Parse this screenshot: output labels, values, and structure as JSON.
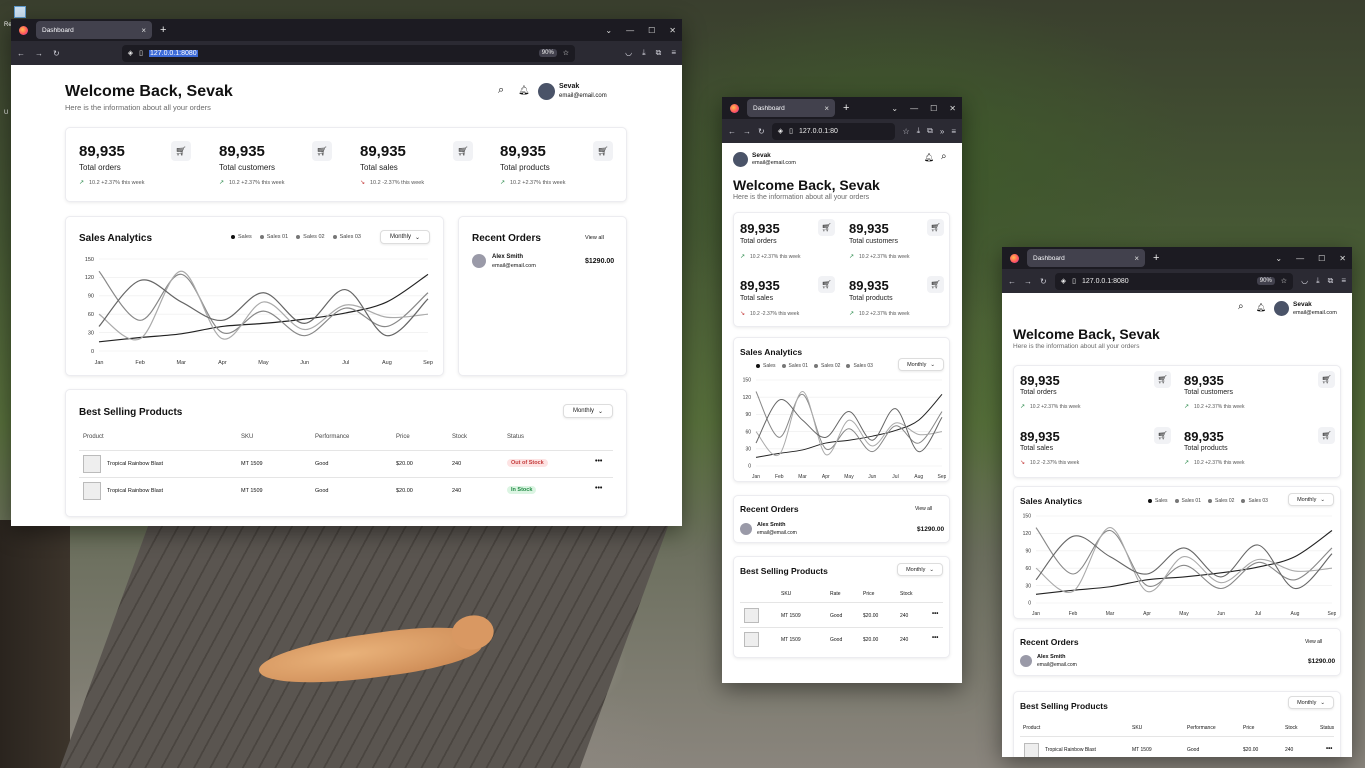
{
  "desktop": {
    "icon_label_1": "Re",
    "icon_label_2": "U"
  },
  "browser": {
    "tab_title": "Dashboard",
    "url": "127.0.0.1:8080",
    "url_small": "127.0.0.1:80",
    "zoom": "90%"
  },
  "header": {
    "title": "Welcome Back, Sevak",
    "subtitle": "Here is the information about all your orders",
    "user_name": "Sevak",
    "user_email": "email@email.com"
  },
  "stats": [
    {
      "value": "89,935",
      "label": "Total orders",
      "change": "10.2 +2.37% this week",
      "trend": "up"
    },
    {
      "value": "89,935",
      "label": "Total customers",
      "change": "10.2 +2.37% this week",
      "trend": "up"
    },
    {
      "value": "89,935",
      "label": "Total sales",
      "change": "10.2 -2.37% this week",
      "trend": "down"
    },
    {
      "value": "89,935",
      "label": "Total products",
      "change": "10.2 +2.37% this week",
      "trend": "up"
    }
  ],
  "sales_analytics": {
    "title": "Sales Analytics",
    "period": "Monthly",
    "legend": [
      "Sales",
      "Sales 01",
      "Sales 02",
      "Sales 03"
    ]
  },
  "chart_data": {
    "type": "line",
    "title": "Sales Analytics",
    "categories": [
      "Jan",
      "Feb",
      "Mar",
      "Apr",
      "May",
      "Jun",
      "Jul",
      "Aug",
      "Sep"
    ],
    "yticks": [
      0,
      30,
      60,
      90,
      120,
      150
    ],
    "ylim": [
      0,
      150
    ],
    "grid": true,
    "legend_position": "top-right",
    "series": [
      {
        "name": "Sales",
        "values": [
          15,
          22,
          28,
          40,
          45,
          52,
          62,
          80,
          125
        ],
        "color": "#222222"
      },
      {
        "name": "Sales 01",
        "values": [
          130,
          50,
          125,
          30,
          65,
          25,
          70,
          40,
          95
        ],
        "color": "#888888"
      },
      {
        "name": "Sales 02",
        "values": [
          60,
          20,
          130,
          20,
          80,
          35,
          75,
          55,
          60
        ],
        "color": "#aaaaaa"
      },
      {
        "name": "Sales 03",
        "values": [
          40,
          115,
          80,
          50,
          95,
          45,
          100,
          25,
          85
        ],
        "color": "#666666"
      }
    ]
  },
  "recent_orders": {
    "title": "Recent Orders",
    "view_all": "View all",
    "items": [
      {
        "name": "Alex Smith",
        "email": "email@email.com",
        "amount": "$1290.00"
      }
    ]
  },
  "best_selling": {
    "title": "Best Selling Products",
    "period": "Monthly",
    "columns": [
      "Product",
      "SKU",
      "Performance",
      "Price",
      "Stock",
      "Status"
    ],
    "columns_narrow": [
      "SKU",
      "Rate",
      "Price",
      "Stock"
    ],
    "rows": [
      {
        "product": "Tropical Rainbow Blast",
        "sku": "MT 1509",
        "performance": "Good",
        "price": "$20.00",
        "stock": "240",
        "status": "Out of Stock"
      },
      {
        "product": "Tropical Rainbow Blast",
        "sku": "MT 1509",
        "performance": "Good",
        "price": "$20.00",
        "stock": "240",
        "status": "In Stock"
      }
    ],
    "more": "•••"
  }
}
